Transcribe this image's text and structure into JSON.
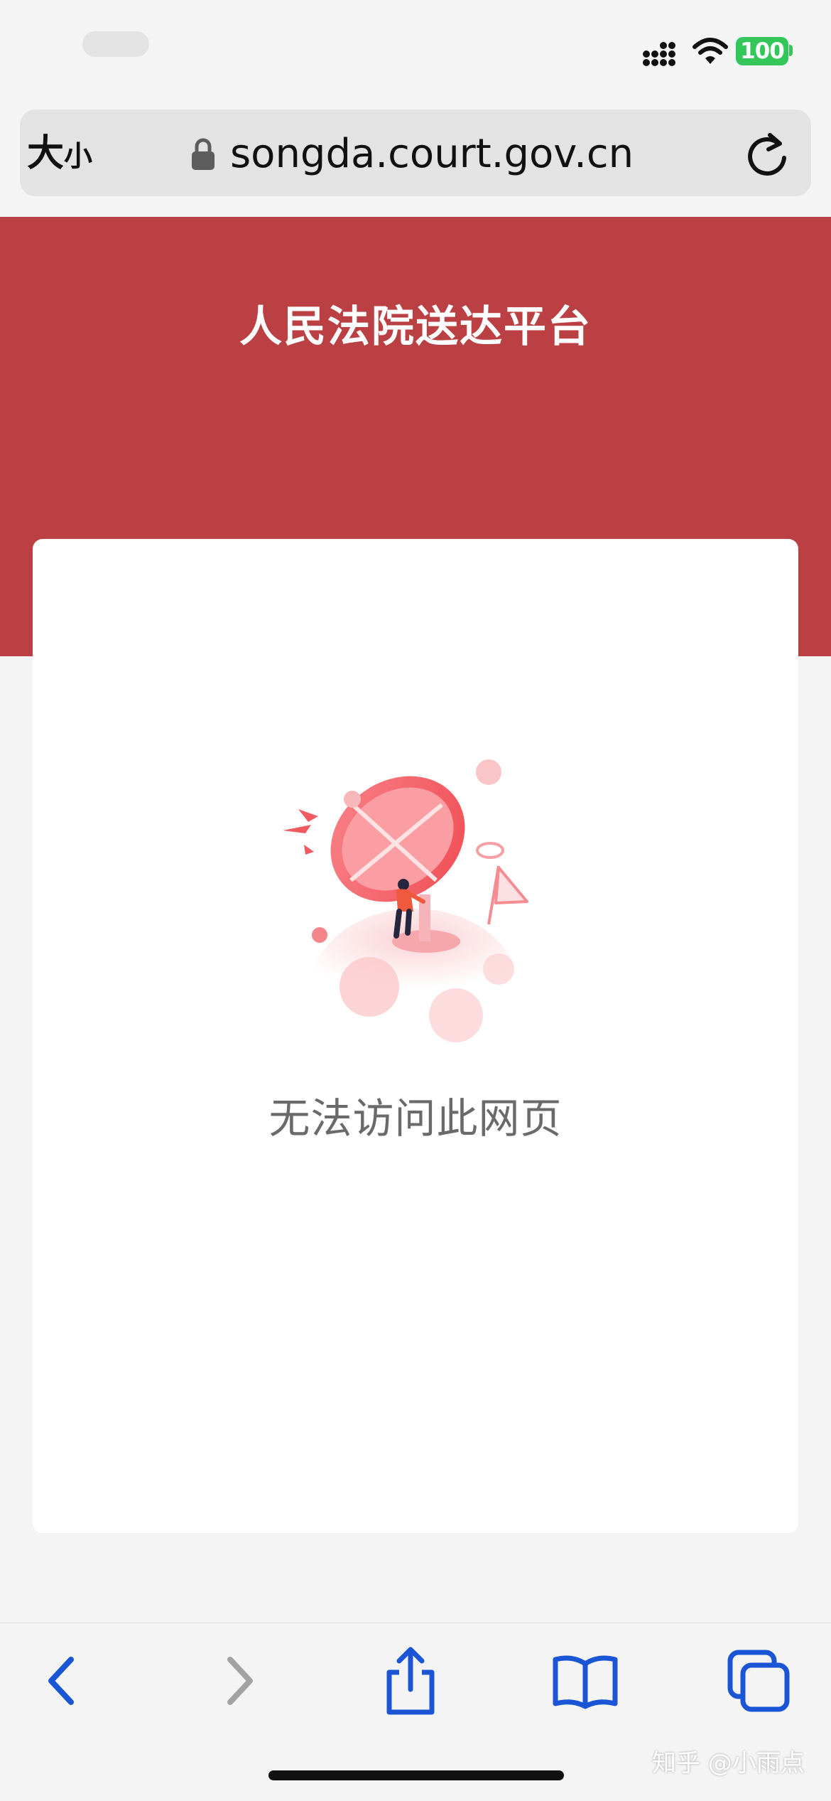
{
  "status_bar": {
    "battery_level": "100",
    "signal_icon": "signal-icon",
    "wifi_icon": "wifi-icon"
  },
  "address_bar": {
    "text_size_label_large": "大",
    "text_size_label_small": "小",
    "lock_icon": "lock-icon",
    "url": "songda.court.gov.cn",
    "reload_icon": "reload-icon"
  },
  "page": {
    "title": "人民法院送达平台",
    "error_message": "无法访问此网页",
    "header_color": "#bb4043"
  },
  "toolbar": {
    "back_icon": "back-arrow-icon",
    "forward_icon": "forward-arrow-icon",
    "share_icon": "share-icon",
    "bookmarks_icon": "bookmarks-icon",
    "tabs_icon": "tabs-icon",
    "accent_color": "#1a55d6"
  },
  "watermark": "知乎 @小雨点"
}
